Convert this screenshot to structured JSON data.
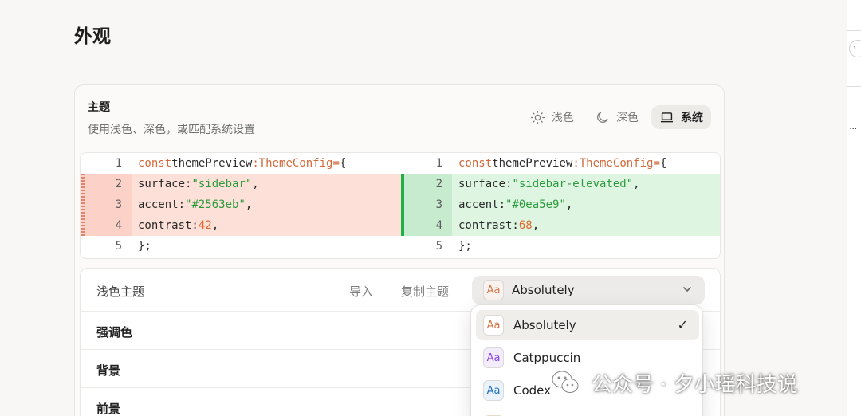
{
  "page": {
    "title": "外观"
  },
  "theme": {
    "title": "主题",
    "description": "使用浅色、深色，或匹配系统设置",
    "modes": [
      {
        "label": "浅色",
        "icon": "sun-icon",
        "active": false
      },
      {
        "label": "深色",
        "icon": "moon-icon",
        "active": false
      },
      {
        "label": "系统",
        "icon": "laptop-icon",
        "active": true
      }
    ]
  },
  "diff": {
    "left": [
      {
        "num": "1",
        "state": "normal"
      },
      {
        "num": "2",
        "state": "deleted"
      },
      {
        "num": "3",
        "state": "deleted"
      },
      {
        "num": "4",
        "state": "deleted"
      },
      {
        "num": "5",
        "state": "normal"
      }
    ],
    "right": [
      {
        "num": "1",
        "state": "normal"
      },
      {
        "num": "2",
        "state": "added"
      },
      {
        "num": "3",
        "state": "added"
      },
      {
        "num": "4",
        "state": "added"
      },
      {
        "num": "5",
        "state": "normal"
      }
    ],
    "tokens": {
      "const": "const",
      "name": "themePreview",
      "colon": ":",
      "type": "ThemeConfig",
      "eq": "=",
      "brace_open": "{",
      "brace_close": "};",
      "surface_key": "surface:",
      "accent_key": "accent:",
      "contrast_key": "contrast:",
      "comma": ",",
      "left_surface": "\"sidebar\"",
      "left_accent": "\"#2563eb\"",
      "left_contrast": "42",
      "right_surface": "\"sidebar-elevated\"",
      "right_accent": "\"#0ea5e9\"",
      "right_contrast": "68"
    },
    "colors": {
      "deleted": "#fde0d8",
      "added": "#def5e2",
      "added_marker": "#1fb046"
    }
  },
  "light_theme": {
    "label": "浅色主题",
    "import_label": "导入",
    "copy_label": "复制主题",
    "selected_theme": "Absolutely",
    "badge_text": "Aa",
    "rows": [
      "强调色",
      "背景",
      "前景"
    ]
  },
  "dropdown": {
    "items": [
      {
        "label": "Absolutely",
        "badge": "Aa",
        "badge_color": "#d4764a",
        "selected": true
      },
      {
        "label": "Catppuccin",
        "badge": "Aa",
        "badge_color": "#8b45e0",
        "selected": false
      },
      {
        "label": "Codex",
        "badge": "Aa",
        "badge_color": "#1f6fc2",
        "selected": false
      }
    ],
    "check": "✓"
  },
  "watermark": {
    "text": "公众号 · 夕小瑶科技说"
  }
}
